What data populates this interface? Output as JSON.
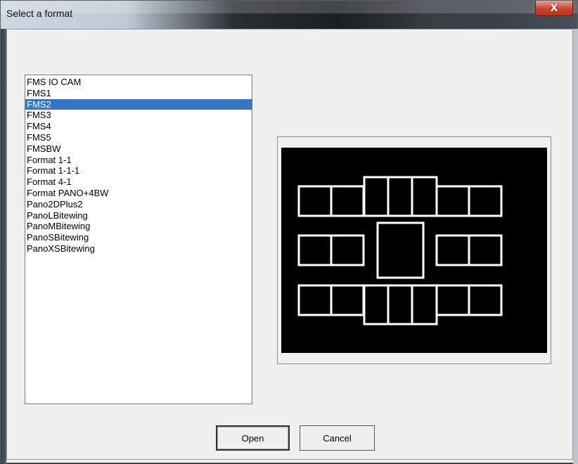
{
  "window": {
    "title": "Select a format",
    "close_glyph": "X"
  },
  "formats": {
    "items": [
      "FMS IO CAM",
      "FMS1",
      "FMS2",
      "FMS3",
      "FMS4",
      "FMS5",
      "FMSBW",
      "Format 1-1",
      "Format 1-1-1",
      "Format 4-1",
      "Format PANO+4BW",
      "Pano2DPlus2",
      "PanoLBitewing",
      "PanoMBitewing",
      "PanoSBitewing",
      "PanoXSBitewing"
    ],
    "selected_index": 2
  },
  "buttons": {
    "open_label": "Open",
    "cancel_label": "Cancel"
  },
  "colors": {
    "selection": "#3477c8",
    "preview_bg": "#000000",
    "preview_stroke": "#ffffff"
  },
  "icons": {
    "close": "close-icon"
  }
}
